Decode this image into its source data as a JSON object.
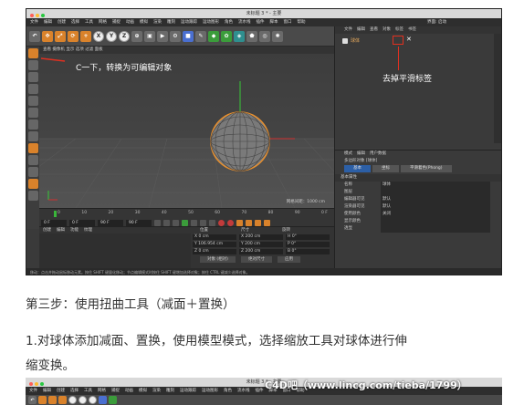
{
  "c4d1": {
    "title": "未标题 3 * - 主要",
    "menus": [
      "文件",
      "编辑",
      "创建",
      "选择",
      "工具",
      "网格",
      "捕捉",
      "动画",
      "模拟",
      "渲染",
      "雕刻",
      "运动跟踪",
      "运动图形",
      "角色",
      "流水线",
      "插件",
      "脚本",
      "窗口",
      "帮助"
    ],
    "menu_right": "界面: 启动",
    "toolbar_icons": [
      "undo-icon",
      "move-icon",
      "scale-icon",
      "rotate-icon",
      "x-axis-icon",
      "y-axis-icon",
      "z-axis-icon",
      "coord-icon",
      "render-region-icon",
      "render-view-icon",
      "render-settings-icon",
      "cube-icon",
      "pen-icon",
      "subdivision-icon",
      "array-icon",
      "deformer-icon",
      "environment-icon",
      "camera-icon",
      "light-icon"
    ],
    "viewport_menu": "查看 摄像机 显示 选项 过滤 面板",
    "annotation_left": "C一下，转换为可编辑对象",
    "grid_readout": "网格间距：1000 cm",
    "timeline_ticks": [
      "0",
      "10",
      "20",
      "30",
      "40",
      "50",
      "60",
      "70",
      "80",
      "90"
    ],
    "timeline_end": "0 F",
    "frame_start": "0 F",
    "frame_current": "0 F",
    "frame_end": "90 F",
    "frame_end2": "90 F",
    "bottom_menu": [
      "创建",
      "编辑",
      "功能",
      "纹理"
    ],
    "coords": {
      "headers": [
        "位置",
        "尺寸",
        "旋转"
      ],
      "rows": [
        {
          "a": "X  0 cm",
          "b": "X  200 cm",
          "c": "H  0°"
        },
        {
          "a": "Y  106.954 cm",
          "b": "Y  200 cm",
          "c": "P  0°"
        },
        {
          "a": "Z  0 cm",
          "b": "Z  200 cm",
          "c": "B  0°"
        }
      ],
      "btn1": "对象 (相对)",
      "btn2": "绝对尺寸",
      "btn3": "应用"
    },
    "status": "移动：点击并拖动鼠标移动元素。按住 SHIFT 键量化移动；节点编辑模式时按住 SHIFT 键增加选择对象；按住 CTRL 键减少选择对象。",
    "rp_menu": [
      "文件",
      "编辑",
      "查看",
      "对象",
      "标签",
      "书签"
    ],
    "object_name": "球体",
    "tag_annotation": "去掉平滑标签",
    "attr_menu": [
      "模式",
      "编辑",
      "用户数据"
    ],
    "attr_objtitle": "多边形对象 [球体]",
    "attr_tabs": [
      "基本",
      "坐标",
      "平滑着色(Phong)"
    ],
    "attr_section": "基本属性",
    "attr_props": [
      {
        "lab": "名称",
        "val": "球体"
      },
      {
        "lab": "图层",
        "val": ""
      },
      {
        "lab": "编辑器可见",
        "val": "默认"
      },
      {
        "lab": "渲染器可见",
        "val": "默认"
      },
      {
        "lab": "使用颜色",
        "val": "关闭"
      },
      {
        "lab": "显示颜色",
        "val": ""
      },
      {
        "lab": "透显",
        "val": ""
      }
    ]
  },
  "step_heading": "第三步：使用扭曲工具（减面＋置换）",
  "step_paragraph_line1": "1.对球体添加减面、置换，使用模型模式，选择缩放工具对球体进行伸",
  "step_paragraph_line2": "缩变换。",
  "c4d2": {
    "title": "未标题 3 * - 主要",
    "menus": [
      "文件",
      "编辑",
      "创建",
      "选择",
      "工具",
      "网格",
      "捕捉",
      "动画",
      "模拟",
      "渲染",
      "雕刻",
      "运动跟踪",
      "运动图形",
      "角色",
      "流水线",
      "插件",
      "脚本",
      "窗口",
      "帮助"
    ]
  },
  "watermark": "C4D吧（www.lincg.com/tieba/1799）"
}
